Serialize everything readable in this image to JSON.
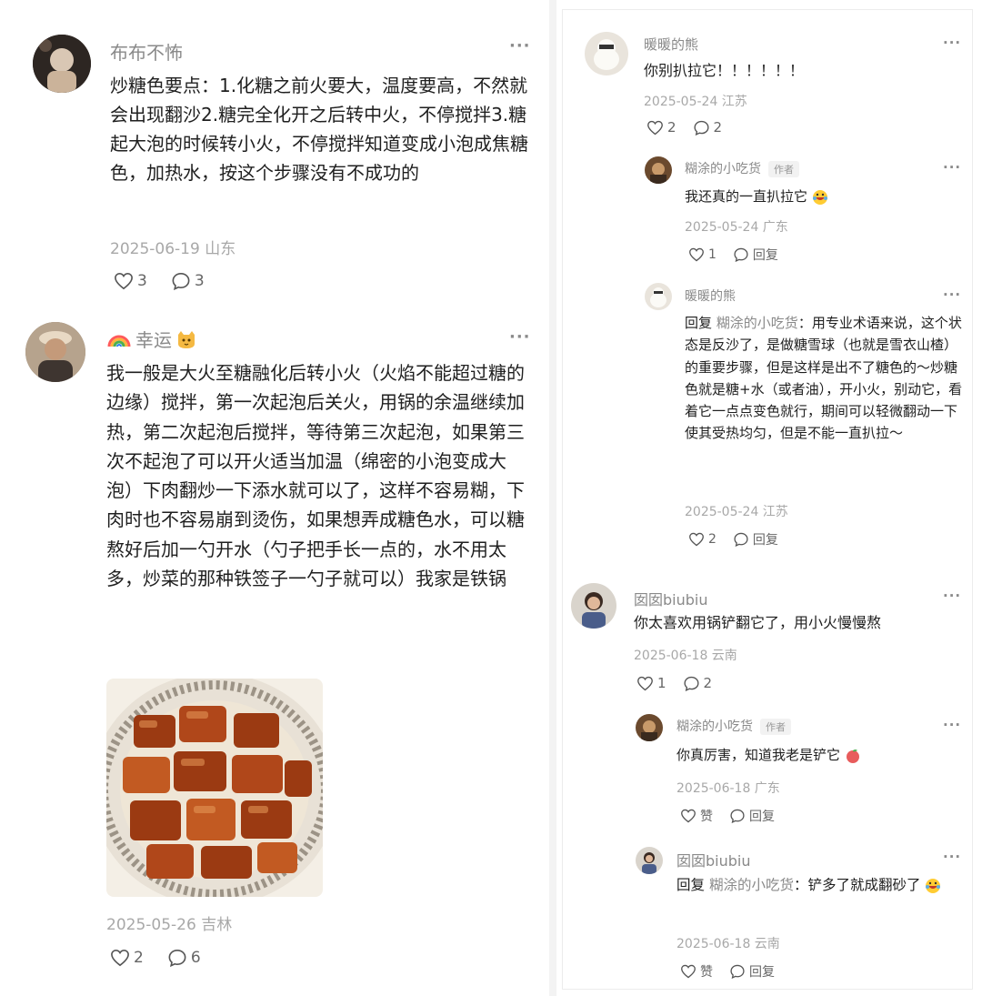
{
  "left": {
    "c1": {
      "user": "布布不怖",
      "text": "炒糖色要点：1.化糖之前火要大，温度要高，不然就会出现翻沙2.糖完全化开之后转中火，不停搅拌3.糖起大泡的时候转小火，不停搅拌知道变成小泡成焦糖色，加热水，按这个步骤没有不成功的",
      "date": "2025-06-19 山东",
      "likes": "3",
      "comments": "3"
    },
    "c2": {
      "user": "幸运",
      "text": "我一般是大火至糖融化后转小火（火焰不能超过糖的边缘）搅拌，第一次起泡后关火，用锅的余温继续加热，第二次起泡后搅拌，等待第三次起泡，如果第三次不起泡了可以开火适当加温（绵密的小泡变成大泡）下肉翻炒一下添水就可以了，这样不容易糊，下肉时也不容易崩到烫伤，如果想弄成糖色水，可以糖熬好后加一勺开水（勺子把手长一点的，水不用太多，炒菜的那种铁签子一勺子就可以）我家是铁锅",
      "date": "2025-05-26 吉林",
      "likes": "2",
      "comments": "6"
    }
  },
  "right": {
    "r1": {
      "user": "暖暖的熊",
      "text": "你别扒拉它！！！！！！",
      "date": "2025-05-24 江苏",
      "likes": "2",
      "comments": "2"
    },
    "r1a": {
      "user": "糊涂的小吃货",
      "tag": "作者",
      "text": "我还真的一直扒拉它",
      "date": "2025-05-24 广东",
      "likes": "1",
      "reply": "回复"
    },
    "r1b": {
      "user": "暖暖的熊",
      "reply_prefix": "回复",
      "reply_to": "糊涂的小吃货",
      "text": "：用专业术语来说，这个状态是反沙了，是做糖雪球（也就是雪衣山楂）的重要步骤，但是这样是出不了糖色的～炒糖色就是糖+水（或者油），开小火，别动它，看着它一点点变色就行，期间可以轻微翻动一下使其受热均匀，但是不能一直扒拉～",
      "date": "2025-05-24 江苏",
      "likes": "2",
      "reply": "回复"
    },
    "r2": {
      "user": "囡囡biubiu",
      "text": "你太喜欢用锅铲翻它了，用小火慢慢熬",
      "date": "2025-06-18 云南",
      "likes": "1",
      "comments": "2"
    },
    "r2a": {
      "user": "糊涂的小吃货",
      "tag": "作者",
      "text": "你真厉害，知道我老是铲它",
      "date": "2025-06-18 广东",
      "likes": "赞",
      "reply": "回复"
    },
    "r2b": {
      "user": "囡囡biubiu",
      "reply_prefix": "回复",
      "reply_to": "糊涂的小吃货",
      "text": "：铲多了就成翻砂了",
      "date": "2025-06-18 云南",
      "likes": "赞",
      "reply": "回复"
    }
  },
  "more_label": "···",
  "icons": [
    "heart-icon",
    "comment-bubble-icon",
    "more-icon",
    "rainbow-icon",
    "cat-icon",
    "laugh-emoji-icon",
    "peach-emoji-icon"
  ]
}
